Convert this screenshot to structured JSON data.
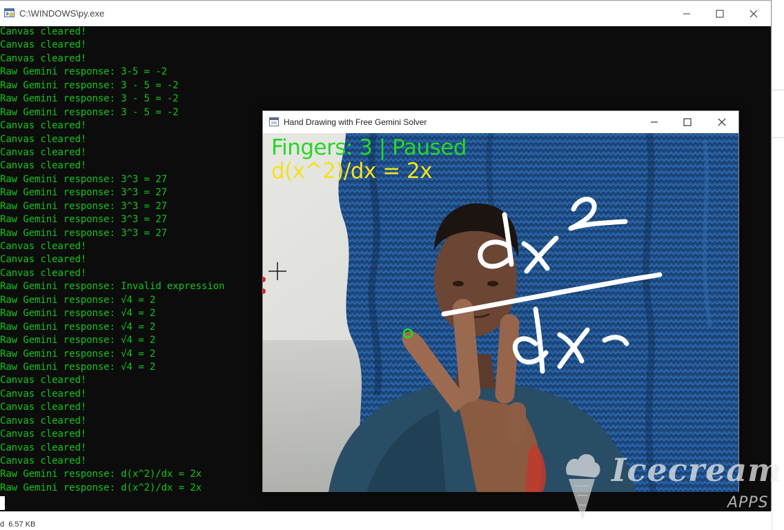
{
  "console": {
    "title": "C:\\WINDOWS\\py.exe",
    "lines": [
      "Canvas cleared!",
      "Canvas cleared!",
      "Canvas cleared!",
      "Raw Gemini response: 3-5 = -2",
      "Raw Gemini response: 3 - 5 = -2",
      "Raw Gemini response: 3 - 5 = -2",
      "Raw Gemini response: 3 - 5 = -2",
      "Canvas cleared!",
      "Canvas cleared!",
      "Canvas cleared!",
      "Canvas cleared!",
      "Raw Gemini response: 3^3 = 27",
      "Raw Gemini response: 3^3 = 27",
      "Raw Gemini response: 3^3 = 27",
      "Raw Gemini response: 3^3 = 27",
      "Raw Gemini response: 3^3 = 27",
      "Canvas cleared!",
      "Canvas cleared!",
      "Canvas cleared!",
      "Raw Gemini response: Invalid expression",
      "Raw Gemini response: √4 = 2",
      "Raw Gemini response: √4 = 2",
      "Raw Gemini response: √4 = 2",
      "Raw Gemini response: √4 = 2",
      "Raw Gemini response: √4 = 2",
      "Raw Gemini response: √4 = 2",
      "Canvas cleared!",
      "Canvas cleared!",
      "Canvas cleared!",
      "Canvas cleared!",
      "Canvas cleared!",
      "Canvas cleared!",
      "Canvas cleared!",
      "Raw Gemini response: d(x^2)/dx = 2x",
      "Raw Gemini response: d(x^2)/dx = 2x"
    ],
    "text_color": "#13c21a"
  },
  "cv_window": {
    "title": "Hand Drawing with Free Gemini Solver",
    "status_overlay": "Fingers: 3 | Paused",
    "result_overlay": "d(x^2)/dx = 2x",
    "status_color": "#27d626",
    "result_color": "#f3e21c"
  },
  "status_bar": {
    "text": "d  6.57 KB"
  },
  "watermark": {
    "text": "Icecream",
    "subtext": "APPS"
  },
  "icons": {
    "minimize": "minimize-icon",
    "maximize": "maximize-icon",
    "close": "close-icon",
    "console_app": "python-console-icon",
    "cv_app": "window-app-icon",
    "crosshair": "crosshair-cursor-icon"
  }
}
